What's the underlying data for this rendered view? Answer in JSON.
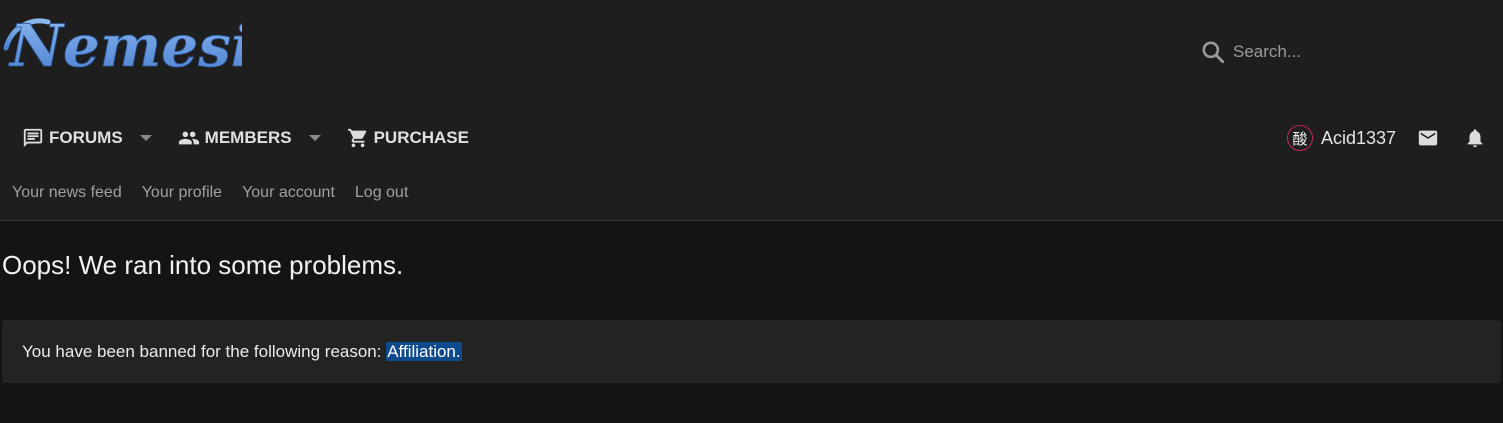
{
  "site": {
    "logo_text": "Nemesis"
  },
  "search": {
    "placeholder": "Search..."
  },
  "nav": {
    "forums": "FORUMS",
    "members": "MEMBERS",
    "purchase": "PURCHASE"
  },
  "user": {
    "avatar_char": "酸",
    "name": "Acid1337"
  },
  "sub_nav": {
    "news_feed": "Your news feed",
    "profile": "Your profile",
    "account": "Your account",
    "logout": "Log out"
  },
  "page": {
    "title": "Oops! We ran into some problems.",
    "error_message": "You have been banned for the following reason: ",
    "ban_reason": "Affiliation."
  },
  "colors": {
    "logo": "#5b8fd8",
    "avatar_ring": "#c0265e",
    "selection": "#0f4a8c"
  }
}
